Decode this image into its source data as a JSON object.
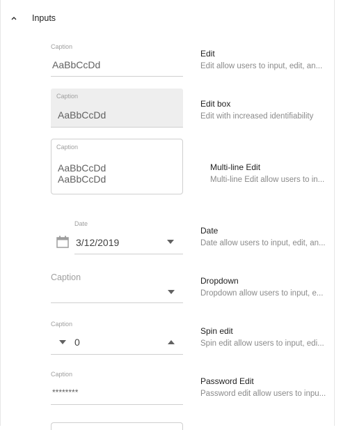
{
  "group": {
    "title": "Inputs",
    "icon": "chevron-up-icon"
  },
  "fields": {
    "edit": {
      "caption": "Caption",
      "value": "AaBbCcDd"
    },
    "edit_box": {
      "caption": "Caption",
      "value": "AaBbCcDd"
    },
    "multiline": {
      "caption": "Caption",
      "line1": "AaBbCcDd",
      "line2": "AaBbCcDd"
    },
    "date": {
      "caption": "Date",
      "value": "3/12/2019",
      "icon": "calendar-icon",
      "dropdown_icon": "caret-down-icon"
    },
    "dropdown": {
      "placeholder": "Caption",
      "dropdown_icon": "caret-down-icon"
    },
    "spin": {
      "caption": "Caption",
      "value": "0",
      "down_icon": "caret-down-icon",
      "up_icon": "caret-up-icon"
    },
    "password": {
      "caption": "Caption",
      "value": "********"
    }
  },
  "descriptions": [
    {
      "title": "Edit",
      "text": "Edit allow users to input, edit, an..."
    },
    {
      "title": "Edit box",
      "text": "Edit with increased identifiability"
    },
    {
      "title": "Multi-line Edit",
      "text": "Multi-line Edit allow users to in..."
    },
    {
      "title": "Date",
      "text": "Date allow users to input, edit, an..."
    },
    {
      "title": "Dropdown",
      "text": "Dropdown allow users to input, e..."
    },
    {
      "title": "Spin edit",
      "text": "Spin edit allow users to input, edi..."
    },
    {
      "title": "Password Edit",
      "text": "Password edit allow users to inpu..."
    }
  ],
  "colors": {
    "caption": "#9e9e9e",
    "value": "#616161",
    "title": "#212121",
    "description": "#8a8a8a",
    "underline": "#cfcfcf",
    "filled_bg": "#eeeeee"
  }
}
